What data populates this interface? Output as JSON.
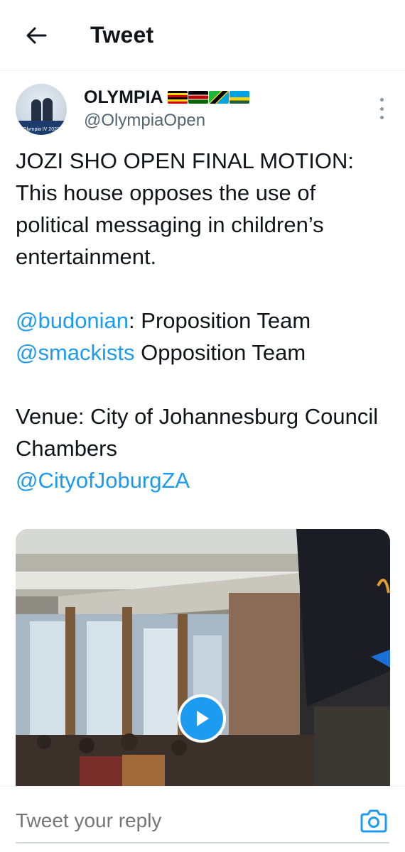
{
  "header": {
    "title": "Tweet",
    "back_icon": "arrow-left-icon"
  },
  "tweet": {
    "author": {
      "display_name": "OLYMPIA",
      "handle": "@OlympiaOpen",
      "avatar_caption": "Olympia IV 2022",
      "flags": [
        "uganda-flag-icon",
        "kenya-flag-icon",
        "tanzania-flag-icon",
        "rwanda-flag-icon"
      ]
    },
    "paragraph1": "JOZI SHO OPEN FINAL MOTION: This house opposes the use of political messaging in children’s entertainment.",
    "proposition": {
      "mention": "@budonian",
      "text": ": Proposition Team"
    },
    "opposition": {
      "mention": "@smackists",
      "text": " Opposition Team"
    },
    "venue": {
      "text": "Venue: City of Johannesburg Council Chambers",
      "mention": "@CityofJoburgZA"
    },
    "media": {
      "type": "video",
      "play_icon": "play-icon"
    }
  },
  "reply": {
    "placeholder": "Tweet your reply",
    "camera_icon": "camera-icon"
  },
  "colors": {
    "link": "#1d9bf0",
    "text": "#0f1419",
    "secondary": "#536471"
  }
}
